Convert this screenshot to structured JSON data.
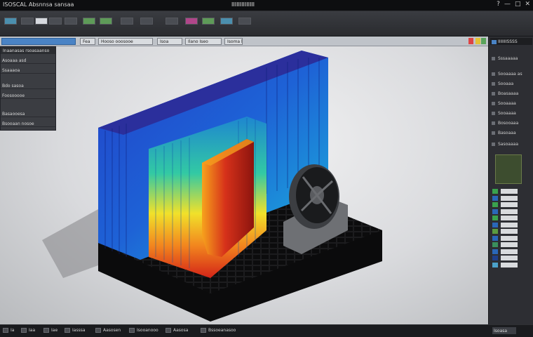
{
  "titlebar": {
    "app_title": "ISOSCAL  Absnnsa sansaa",
    "document_title": "IIIIIIIIIIIIII",
    "window_controls": [
      "?",
      "—",
      "□",
      "✕"
    ]
  },
  "ribbon": {
    "buttons": [
      "rb1",
      "rb2",
      "rb3",
      "rb4",
      "rb5",
      "rb6",
      "rb7",
      "rb8",
      "rb9",
      "rb10",
      "rb11",
      "rb12",
      "rb13",
      "rb14"
    ]
  },
  "tabs": {
    "items": [
      {
        "label": ""
      },
      {
        "label": "Fea"
      },
      {
        "label": "Hooso  ooosooe"
      },
      {
        "label": "Isoa"
      },
      {
        "label": "Ilano  Iseo"
      },
      {
        "label": "Isoma  lana"
      }
    ]
  },
  "left_panel": {
    "title": "Inaanasas rsoasaanso",
    "rows": [
      "Asoaaa  asd",
      "Ssaaaoa",
      "Bdo  sasoa",
      "Foosooooe",
      "Basaooesa",
      "Bsooaan  nosoe"
    ]
  },
  "right_panel": {
    "header": "IIIIIIISSSS",
    "rows": [
      "Sssaaaaa",
      "Sooaaaa  as",
      "Sooaaa",
      "Boasaaaa",
      "Sooaaaa",
      "Sooaaaa",
      "Bosooaaa",
      "Basoaaa",
      "Sasoaaaa"
    ],
    "legend_colors": [
      "#3aa24d",
      "#2a67b8",
      "#3aa24d",
      "#2a67b8",
      "#3aa24d",
      "#2a67b8",
      "#5b9c3f",
      "#2a67b8",
      "#3a8f5c",
      "#2a67b8",
      "#1f3f8a",
      "#4ba1c9"
    ]
  },
  "statusbar": {
    "items": [
      "Ia",
      "Iaa",
      "Iae",
      "Iasssa",
      "Aasosen",
      "Isooanooo",
      "Aasosa",
      "Bssoeanasoo"
    ],
    "right_label": "Isoasa"
  },
  "colors": {
    "accent": "#4a83c5",
    "heat_hot": "#c8221a",
    "heat_cold": "#1b2fb8"
  }
}
